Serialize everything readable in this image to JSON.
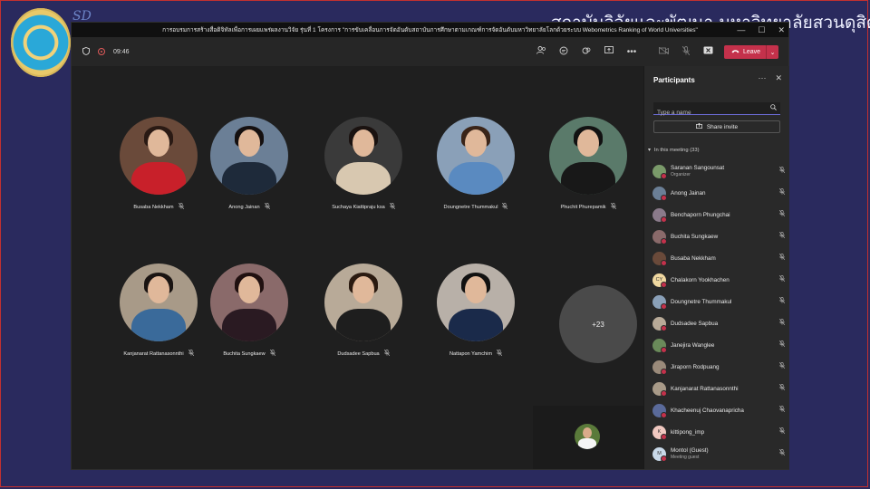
{
  "background": {
    "org_title": "สถาบันวิจัยและพัฒนา มหาวิทยาลัยสวนดุสิต",
    "logo_mark": "SD"
  },
  "window": {
    "title": "การอบรมการสร้างสื่อดิจิทัลเพื่อการเผยแพร่ผลงานวิจัย รุ่นที่ 1 โครงการ \"การขับเคลื่อนการจัดอันดับสถาบันการศึกษาตามเกณฑ์การจัดอันดับมหาวิทยาลัยโลกด้วยระบบ Webometrics Ranking of World Universities\"",
    "controls": [
      "—",
      "☐",
      "✕"
    ]
  },
  "toolbar": {
    "timer": "09:46",
    "leave_label": "Leave"
  },
  "tiles": [
    {
      "name": "Busaba Nekkham",
      "bg": "#6a4a3a",
      "shirt": "#c8202a",
      "hair": "#2a1a14"
    },
    {
      "name": "Anong Jainan",
      "bg": "#6b7f96",
      "shirt": "#1e2a3a",
      "hair": "#151010"
    },
    {
      "name": "Suchaya Kiattipraju ksa",
      "bg": "#3a3a3a",
      "shirt": "#d8c8b0",
      "hair": "#1a1210"
    },
    {
      "name": "Doungnetre Thummakul",
      "bg": "#8aa0b8",
      "shirt": "#5a8ac0",
      "hair": "#3a2418"
    },
    {
      "name": "Phuchit Phurepamik",
      "bg": "#5a7a6a",
      "shirt": "#181818",
      "hair": "#121212"
    },
    {
      "name": "Kanjanarat Rattanasonnthi",
      "bg": "#a89a88",
      "shirt": "#3a6a9a",
      "hair": "#1a1412"
    },
    {
      "name": "Buchita Sungkaew",
      "bg": "#8a6a6a",
      "shirt": "#2a1a22",
      "hair": "#201010"
    },
    {
      "name": "Dudsadee Sapbua",
      "bg": "#b8aa98",
      "shirt": "#1e1e1e",
      "hair": "#2a1a10"
    },
    {
      "name": "Nattapon Yamchim",
      "bg": "#b8b0a8",
      "shirt": "#1a2a4a",
      "hair": "#111111"
    }
  ],
  "more_tile": "+23",
  "panel": {
    "title": "Participants",
    "search_placeholder": "Type a name",
    "share_label": "Share invite",
    "section_label": "In this meeting (33)",
    "participants": [
      {
        "name": "Saranan Sangounsat",
        "role": "Organizer",
        "avatar": "#7a9a6a",
        "initials": ""
      },
      {
        "name": "Anong Jainan",
        "role": "",
        "avatar": "#6b7f96",
        "initials": ""
      },
      {
        "name": "Benchaporn Phungchai",
        "role": "",
        "avatar": "#8a7a8a",
        "initials": ""
      },
      {
        "name": "Buchita Sungkaew",
        "role": "",
        "avatar": "#8a6a6a",
        "initials": ""
      },
      {
        "name": "Busaba Nekkham",
        "role": "",
        "avatar": "#6a4a3a",
        "initials": ""
      },
      {
        "name": "Chalakorn Yookhachen",
        "role": "",
        "avatar": "#f0d8a0",
        "initials": "CY"
      },
      {
        "name": "Doungnetre Thummakul",
        "role": "",
        "avatar": "#8aa0b8",
        "initials": ""
      },
      {
        "name": "Dudsadee Sapbua",
        "role": "",
        "avatar": "#b8aa98",
        "initials": ""
      },
      {
        "name": "Janejira Wanglee",
        "role": "",
        "avatar": "#6a8a5a",
        "initials": ""
      },
      {
        "name": "Jiraporn Rodpuang",
        "role": "",
        "avatar": "#9a8a7a",
        "initials": ""
      },
      {
        "name": "Kanjanarat Rattanasonnthi",
        "role": "",
        "avatar": "#a89a88",
        "initials": ""
      },
      {
        "name": "Khacheenuj Chaovanapricha",
        "role": "",
        "avatar": "#5a6a9a",
        "initials": ""
      },
      {
        "name": "kittipong_imp",
        "role": "",
        "avatar": "#f0c8c0",
        "initials": "K"
      },
      {
        "name": "Montol (Guest)",
        "role": "Meeting guest",
        "avatar": "#c8d8e8",
        "initials": "M"
      }
    ]
  }
}
